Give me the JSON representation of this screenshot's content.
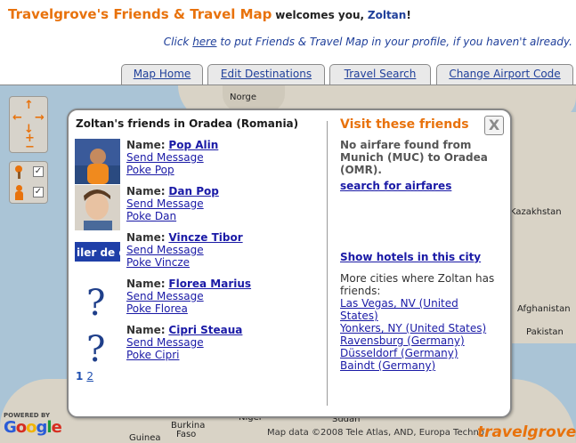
{
  "header": {
    "app_title": "Travelgrove's Friends & Travel Map",
    "welcome_text": "welcomes you,",
    "user_name": "Zoltan",
    "excl": "!",
    "profile_prefix": "Click ",
    "profile_link": "here",
    "profile_suffix": " to put Friends & Travel Map in your profile, if you haven't already."
  },
  "tabs": [
    "Map Home",
    "Edit Destinations",
    "Travel Search",
    "Change Airport Code"
  ],
  "map_labels": [
    "Norge",
    "Kazakhstan",
    "Afghanistan",
    "Pakistan",
    "Sudan",
    "Burkina",
    "Faso",
    "Niger",
    "Guinea"
  ],
  "map_controls": {
    "up": "↑",
    "down": "↓",
    "left": "←",
    "right": "→",
    "zoom_in": "+",
    "zoom_out": "−",
    "checks": [
      "✓",
      "✓"
    ]
  },
  "popup": {
    "title": "Zoltan's friends in Oradea (Romania)",
    "name_label": "Name:",
    "friends": [
      {
        "name": "Pop Alin",
        "send": "Send Message",
        "poke": "Poke Pop",
        "avatar": "photo"
      },
      {
        "name": "Dan Pop",
        "send": "Send Message",
        "poke": "Poke Dan",
        "avatar": "photo"
      },
      {
        "name": "Vincze Tibor",
        "send": "Send Message",
        "poke": "Poke Vincze",
        "avatar": "logo",
        "avatar_text": "iler de c"
      },
      {
        "name": "Florea Marius",
        "send": "Send Message",
        "poke": "Poke Florea",
        "avatar": "unknown"
      },
      {
        "name": "Cipri Steaua",
        "send": "Send Message",
        "poke": "Poke Cipri",
        "avatar": "unknown"
      }
    ],
    "pages": [
      "1",
      "2"
    ],
    "current_page": "1",
    "close_glyph": "X",
    "visit_title": "Visit these friends",
    "no_airfare": "No airfare found from Munich (MUC) to Oradea (OMR).",
    "search_link": "search for airfares",
    "hotels_link": "Show hotels in this city",
    "more_cities_text": "More cities where Zoltan has friends:",
    "cities": [
      "Las Vegas, NV (United States)",
      "Yonkers, NY (United States)",
      "Ravensburg (Germany)",
      "Düsseldorf (Germany)",
      "Baindt (Germany)"
    ]
  },
  "footer": {
    "copyright": "Map data ©2008 Tele Atlas, AND, Europa Techno",
    "powered_by": "POWERED BY",
    "google": "Google",
    "brand": "travelgrove"
  },
  "colors": {
    "accent": "#e8720c",
    "link": "#1a1aa6",
    "sea": "#aac4d6",
    "land": "#d9d3c6"
  }
}
